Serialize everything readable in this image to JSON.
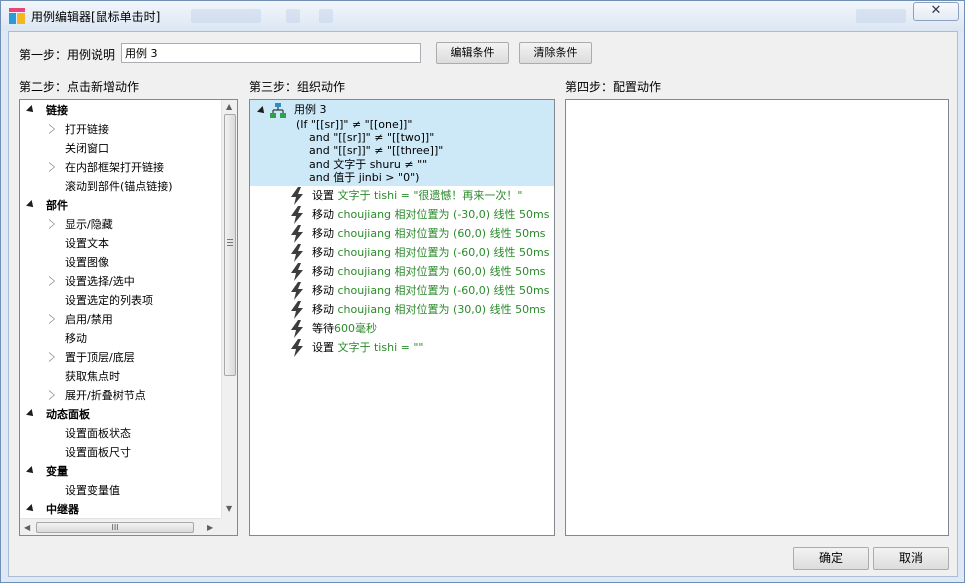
{
  "window": {
    "title": "用例编辑器[鼠标单击时]",
    "close_glyph": "✕"
  },
  "step1": {
    "label": "第一步：用例说明",
    "case_name": "用例 3",
    "edit_button": "编辑条件",
    "clear_button": "清除条件"
  },
  "step2": {
    "label": "第二步：点击新增动作",
    "tree": [
      {
        "text": "链接",
        "level": 0,
        "expander": "open"
      },
      {
        "text": "打开链接",
        "level": 1,
        "expander": "closed"
      },
      {
        "text": "关闭窗口",
        "level": 1,
        "expander": "none"
      },
      {
        "text": "在内部框架打开链接",
        "level": 1,
        "expander": "closed"
      },
      {
        "text": "滚动到部件(锚点链接)",
        "level": 1,
        "expander": "none"
      },
      {
        "text": "部件",
        "level": 0,
        "expander": "open"
      },
      {
        "text": "显示/隐藏",
        "level": 1,
        "expander": "closed"
      },
      {
        "text": "设置文本",
        "level": 1,
        "expander": "none"
      },
      {
        "text": "设置图像",
        "level": 1,
        "expander": "none"
      },
      {
        "text": "设置选择/选中",
        "level": 1,
        "expander": "closed"
      },
      {
        "text": "设置选定的列表项",
        "level": 1,
        "expander": "none"
      },
      {
        "text": "启用/禁用",
        "level": 1,
        "expander": "closed"
      },
      {
        "text": "移动",
        "level": 1,
        "expander": "none"
      },
      {
        "text": "置于顶层/底层",
        "level": 1,
        "expander": "closed"
      },
      {
        "text": "获取焦点时",
        "level": 1,
        "expander": "none"
      },
      {
        "text": "展开/折叠树节点",
        "level": 1,
        "expander": "closed"
      },
      {
        "text": "动态面板",
        "level": 0,
        "expander": "open"
      },
      {
        "text": "设置面板状态",
        "level": 1,
        "expander": "none"
      },
      {
        "text": "设置面板尺寸",
        "level": 1,
        "expander": "none"
      },
      {
        "text": "变量",
        "level": 0,
        "expander": "open"
      },
      {
        "text": "设置变量值",
        "level": 1,
        "expander": "none"
      },
      {
        "text": "中继器",
        "level": 0,
        "expander": "open"
      }
    ],
    "hscroll_grip": "III"
  },
  "step3": {
    "label": "第三步：组织动作",
    "case_title": "用例 3",
    "conditions": [
      "(If \"[[sr]]\" ≠ \"[[one]]\"",
      "and \"[[sr]]\" ≠ \"[[two]]\"",
      "and \"[[sr]]\" ≠ \"[[three]]\"",
      "and 文字于 shuru ≠ \"\"",
      "and 值于 jinbi > \"0\")"
    ],
    "actions": [
      {
        "verb": "设置",
        "detail": "文字于 tishi = \"很遗憾！再来一次！\""
      },
      {
        "verb": "移动",
        "detail": "choujiang 相对位置为 (-30,0) 线性 50ms"
      },
      {
        "verb": "移动",
        "detail": "choujiang 相对位置为 (60,0) 线性 50ms"
      },
      {
        "verb": "移动",
        "detail": "choujiang 相对位置为 (-60,0) 线性 50ms"
      },
      {
        "verb": "移动",
        "detail": "choujiang 相对位置为 (60,0) 线性 50ms"
      },
      {
        "verb": "移动",
        "detail": "choujiang 相对位置为 (-60,0) 线性 50ms"
      },
      {
        "verb": "移动",
        "detail": "choujiang 相对位置为 (30,0) 线性 50ms"
      },
      {
        "verb": "等待",
        "detail": "600毫秒"
      },
      {
        "verb": "设置",
        "detail": "文字于 tishi = \"\""
      }
    ]
  },
  "step4": {
    "label": "第四步：配置动作"
  },
  "footer": {
    "ok_button": "确定",
    "cancel_button": "取消"
  },
  "colors": {
    "selection": "#cde8f7",
    "action_detail": "#2b8a2b",
    "frame": "#dfe9f5"
  }
}
